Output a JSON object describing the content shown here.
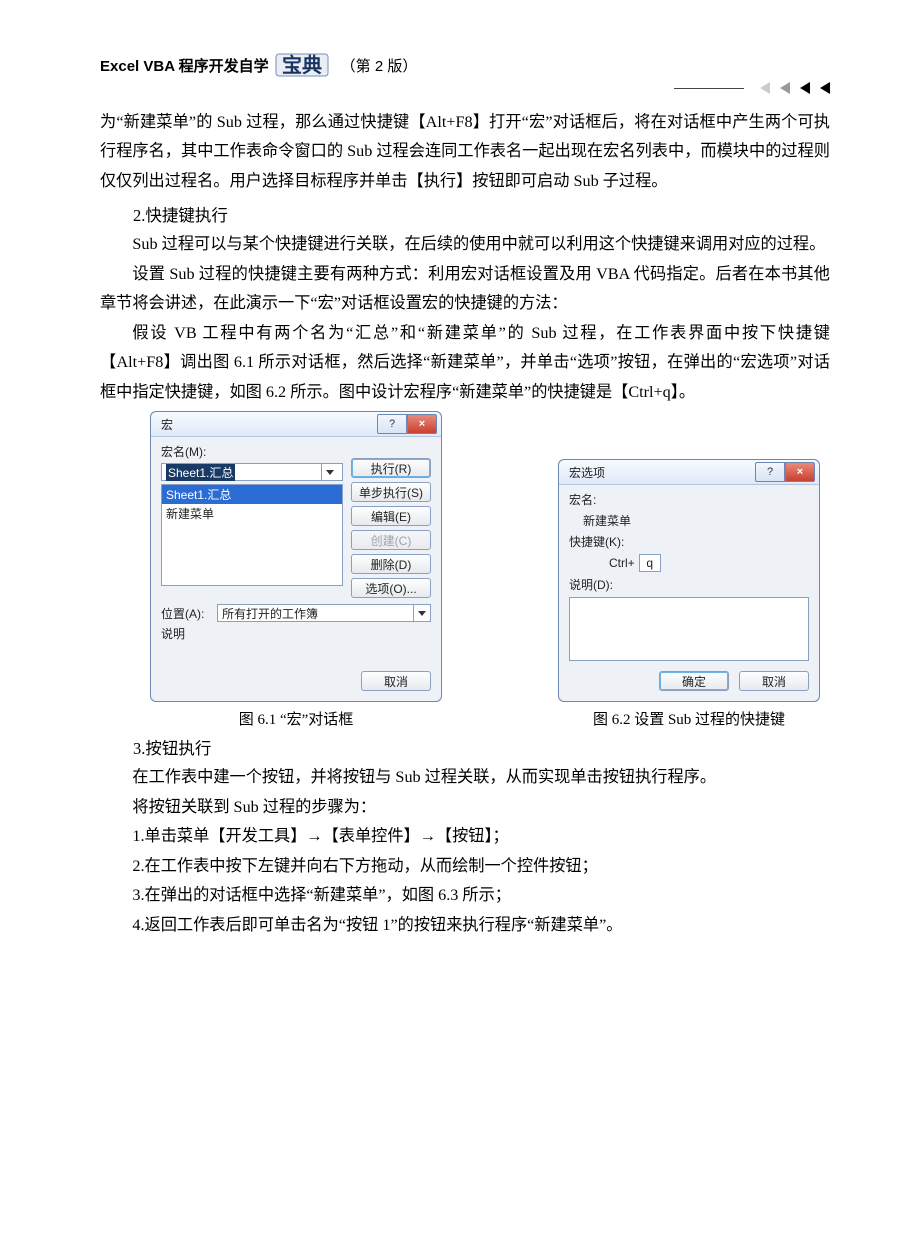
{
  "header": {
    "title_left": "Excel VBA 程序开发自学",
    "badge_text": "宝典",
    "edition": "（第 2 版）"
  },
  "para1": "为“新建菜单”的 Sub 过程，那么通过快捷键【Alt+F8】打开“宏”对话框后，将在对话框中产生两个可执行程序名，其中工作表命令窗口的 Sub 过程会连同工作表名一起出现在宏名列表中，而模块中的过程则仅仅列出过程名。用户选择目标程序并单击【执行】按钮即可启动 Sub 子过程。",
  "sec2_title": "2.快捷键执行",
  "para2": "Sub 过程可以与某个快捷键进行关联，在后续的使用中就可以利用这个快捷键来调用对应的过程。",
  "para3": "设置 Sub 过程的快捷键主要有两种方式：利用宏对话框设置及用 VBA 代码指定。后者在本书其他章节将会讲述，在此演示一下“宏”对话框设置宏的快捷键的方法：",
  "para4": "假设 VB 工程中有两个名为“汇总”和“新建菜单”的 Sub 过程，在工作表界面中按下快捷键【Alt+F8】调出图 6.1 所示对话框，然后选择“新建菜单”，并单击“选项”按钮，在弹出的“宏选项”对话框中指定快捷键，如图 6.2 所示。图中设计宏程序“新建菜单”的快捷键是【Ctrl+q】。",
  "macro_dialog": {
    "title": "宏",
    "name_label": "宏名(M):",
    "name_value": "Sheet1.汇总",
    "list": {
      "item_selected": "Sheet1.汇总",
      "item_2": "新建菜单"
    },
    "buttons": {
      "run": "执行(R)",
      "step": "单步执行(S)",
      "edit": "编辑(E)",
      "create": "创建(C)",
      "delete": "删除(D)",
      "options": "选项(O)..."
    },
    "location_label": "位置(A):",
    "location_value": "所有打开的工作簿",
    "desc_label": "说明",
    "cancel": "取消",
    "help_btn": "?",
    "close_btn": "×"
  },
  "options_dialog": {
    "title": "宏选项",
    "name_label": "宏名:",
    "name_value": "新建菜单",
    "shortcut_label": "快捷键(K):",
    "shortcut_prefix": "Ctrl+",
    "shortcut_key": "q",
    "desc_label": "说明(D):",
    "ok": "确定",
    "cancel": "取消",
    "help_btn": "?",
    "close_btn": "×"
  },
  "caption1": "图 6.1   “宏”对话框",
  "caption2": "图 6.2    设置 Sub 过程的快捷键",
  "sec3_title": "3.按钮执行",
  "para5": "在工作表中建一个按钮，并将按钮与 Sub 过程关联，从而实现单击按钮执行程序。",
  "para6": "将按钮关联到 Sub 过程的步骤为：",
  "step1": "1.单击菜单【开发工具】→【表单控件】→【按钮】；",
  "step2": "2.在工作表中按下左键并向右下方拖动，从而绘制一个控件按钮；",
  "step3": "3.在弹出的对话框中选择“新建菜单”，如图 6.3 所示；",
  "step4": "4.返回工作表后即可单击名为“按钮 1”的按钮来执行程序“新建菜单”。"
}
